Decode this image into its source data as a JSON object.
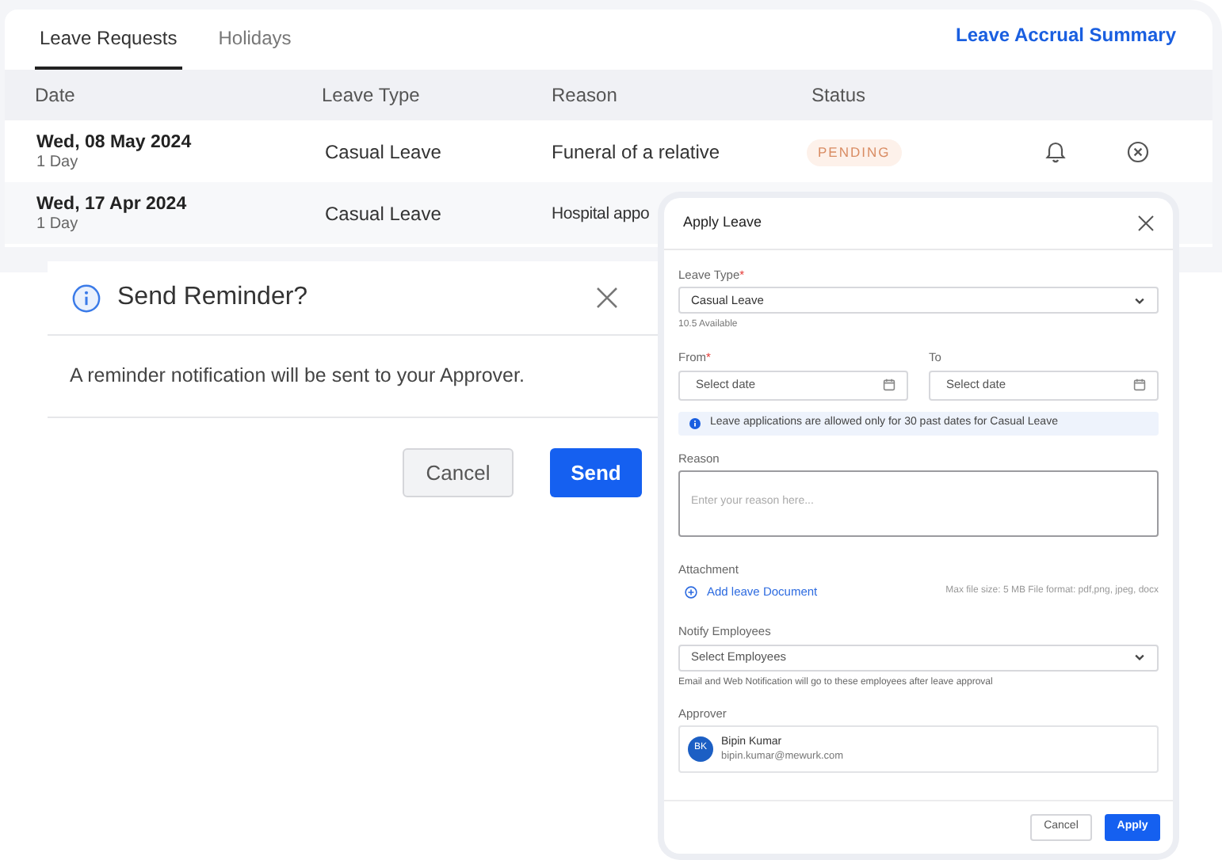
{
  "tabs": [
    {
      "label": "Leave Requests",
      "selected": true
    },
    {
      "label": "Holidays",
      "selected": false
    }
  ],
  "summary_link": "Leave Accrual Summary",
  "table": {
    "columns": [
      "Date",
      "Leave Type",
      "Reason",
      "Status"
    ],
    "rows": [
      {
        "date": "Wed, 08 May 2024",
        "duration": "1 Day",
        "leave_type": "Casual Leave",
        "reason": "Funeral of a relative",
        "status": "PENDING",
        "actions": true
      },
      {
        "date": "Wed, 17 Apr 2024",
        "duration": "1 Day",
        "leave_type": "Casual Leave",
        "reason": "Hospital appo"
      }
    ]
  },
  "reminder_dialog": {
    "title": "Send Reminder?",
    "message": "A reminder notification will be sent to your Approver.",
    "cancel": "Cancel",
    "confirm": "Send"
  },
  "apply_leave": {
    "title": "Apply Leave",
    "leave_type": {
      "label": "Leave Type",
      "required_mark": "*",
      "value": "Casual Leave",
      "available": "10.5 Available"
    },
    "from": {
      "label": "From",
      "required_mark": "*",
      "placeholder": "Select date"
    },
    "to": {
      "label": "To",
      "placeholder": "Select date"
    },
    "notice": "Leave applications are allowed only for 30 past dates for Casual Leave",
    "reason": {
      "label": "Reason",
      "placeholder": "Enter your reason here..."
    },
    "attachment": {
      "label": "Attachment",
      "action": "Add leave Document",
      "hint": "Max file size: 5 MB File format: pdf,png, jpeg, docx"
    },
    "notify": {
      "label": "Notify Employees",
      "placeholder": "Select Employees",
      "hint": "Email and Web Notification will go to these employees after leave approval"
    },
    "approver": {
      "label": "Approver",
      "initials": "BK",
      "name": "Bipin Kumar",
      "email": "bipin.kumar@mewurk.com"
    },
    "cancel": "Cancel",
    "confirm": "Apply"
  }
}
